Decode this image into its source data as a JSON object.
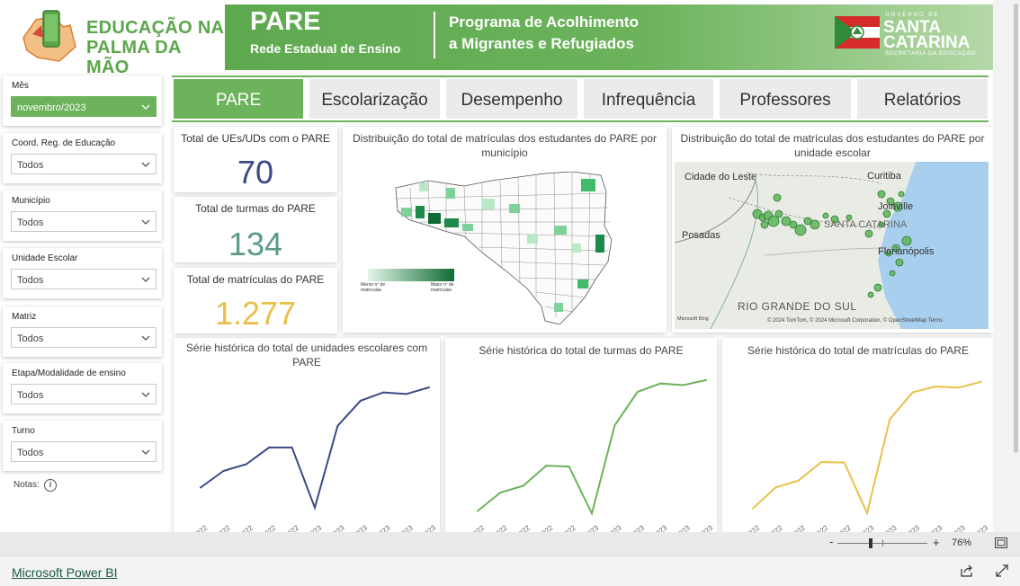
{
  "header": {
    "logo_line1": "EDUCAÇÃO NA",
    "logo_line2": "PALMA DA MÃO",
    "title": "PARE",
    "subtitle": "Rede Estadual de Ensino",
    "program_line1": "Programa de Acolhimento",
    "program_line2": "a Migrantes e Refugiados",
    "gov_small": "GOVERNO DE",
    "gov_line1": "SANTA",
    "gov_line2": "CATARINA",
    "gov_secretaria": "SECRETARIA DA EDUCAÇÃO"
  },
  "filters": [
    {
      "label": "Mês",
      "value": "novembro/2023",
      "selected": true
    },
    {
      "label": "Coord. Reg. de Educação",
      "value": "Todos"
    },
    {
      "label": "Município",
      "value": "Todos"
    },
    {
      "label": "Unidade Escolar",
      "value": "Todos"
    },
    {
      "label": "Matriz",
      "value": "Todos"
    },
    {
      "label": "Etapa/Modalidade de ensino",
      "value": "Todos"
    },
    {
      "label": "Turno",
      "value": "Todos"
    }
  ],
  "notas_label": "Notas:",
  "tabs": [
    "PARE",
    "Escolarização",
    "Desempenho",
    "Infrequência",
    "Professores",
    "Relatórios"
  ],
  "kpis": [
    {
      "title": "Total de UEs/UDs com o PARE",
      "value": "70",
      "color": "#3b4a86"
    },
    {
      "title": "Total de turmas do PARE",
      "value": "134",
      "color": "#5c9a8b"
    },
    {
      "title": "Total de matrículas do PARE",
      "value": "1.277",
      "color": "#e8c04a"
    }
  ],
  "map_municipio": {
    "title": "Distribuição do total de matrículas dos estudantes do PARE por município",
    "legend_min": "Menor nº de matrículas",
    "legend_max": "Maior nº de matrículas"
  },
  "map_escola": {
    "title": "Distribuição do total de matrículas dos estudantes do PARE por unidade escolar",
    "labels": [
      "Cidade do Leste",
      "Curitiba",
      "Joinville",
      "SANTA CATARINA",
      "Posadas",
      "Florianópolis",
      "RIO GRANDE DO SUL"
    ],
    "attribution": "© 2024 TomTom, © 2024 Microsoft Corporation, © OpenStreetMap  Terms",
    "bing": "Microsoft Bing"
  },
  "chart_data": [
    {
      "type": "line",
      "title": "Série histórica do total de unidades escolares com PARE",
      "x": [
        "jul/2022",
        "ago/2022",
        "set/2022",
        "out/2022",
        "nov/2022",
        "fev/2023",
        "mar/2023",
        "abr/2023",
        "mai/2023",
        "jun/2023",
        "jul/2023"
      ],
      "x_ticklabels": [
        "jul/2022",
        "ago/2022",
        "set/2022",
        "out/2022",
        "nov/2022",
        "fev/2023",
        "mar/2023",
        "abr/2023",
        "mai/2023",
        "jun/2023",
        "jul/2023"
      ],
      "values": [
        18,
        28,
        32,
        42,
        42,
        6,
        55,
        70,
        75,
        74,
        78
      ],
      "ylim": [
        0,
        85
      ],
      "color": "#3b4a86"
    },
    {
      "type": "line",
      "title": "Série histórica do total de turmas do PARE",
      "x": [
        "jul/2022",
        "ago/2022",
        "set/2022",
        "out/2022",
        "nov/2022",
        "fev/2023",
        "mar/2023",
        "abr/2023",
        "mai/2023",
        "jun/2023",
        "jul/2023"
      ],
      "x_ticklabels": [
        "jul/2022",
        "ago/2022",
        "set/2022",
        "out/2022",
        "nov/2022",
        "fev/2023",
        "mar/2023",
        "abr/2023",
        "mai/2023",
        "jun/2023",
        "jul/2023"
      ],
      "values": [
        8,
        30,
        38,
        62,
        61,
        5,
        110,
        150,
        160,
        158,
        164
      ],
      "ylim": [
        0,
        180
      ],
      "color": "#6cb35c"
    },
    {
      "type": "line",
      "title": "Série histórica do total de matrículas do PARE",
      "x": [
        "jul/2022",
        "ago/2022",
        "set/2022",
        "out/2022",
        "nov/2022",
        "fev/2023",
        "mar/2023",
        "abr/2023",
        "mai/2023",
        "jun/2023",
        "jul/2023"
      ],
      "x_ticklabels": [
        "jul/2022",
        "ago/2022",
        "set/2022",
        "out/2022",
        "nov/2022",
        "fev/2023",
        "mar/2023",
        "abr/2023",
        "mai/2023",
        "jun/2023",
        "jul/2023"
      ],
      "values": [
        80,
        260,
        320,
        480,
        475,
        40,
        850,
        1080,
        1130,
        1120,
        1170
      ],
      "ylim": [
        0,
        1300
      ],
      "color": "#e8c04a"
    }
  ],
  "zoom": {
    "minus": "-",
    "plus": "+",
    "value": "76%"
  },
  "footer": {
    "link": "Microsoft Power BI"
  }
}
